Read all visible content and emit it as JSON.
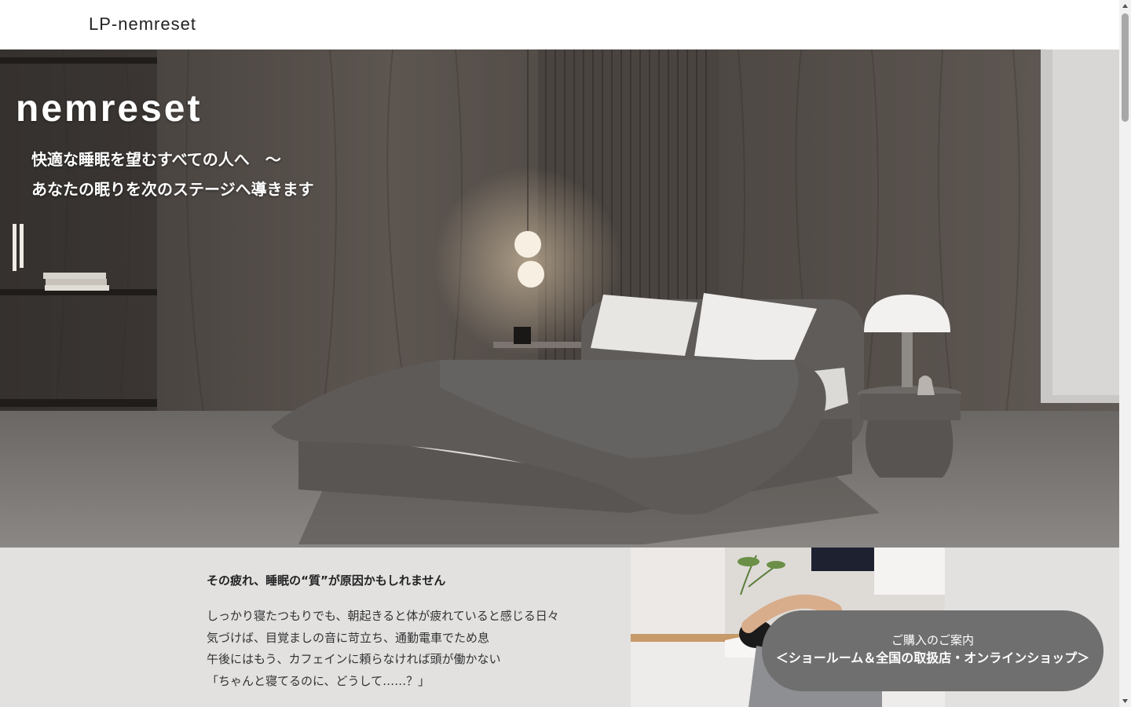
{
  "header": {
    "title": "LP-nemreset"
  },
  "hero": {
    "brand": "nemreset",
    "tagline_1": "快適な睡眠を望むすべての人へ　～",
    "tagline_2": "あなたの眠りを次のステージへ導きます"
  },
  "intro": {
    "heading": "その疲れ、睡眠の“質”が原因かもしれません",
    "lines": [
      "しっかり寝たつもりでも、朝起きると体が疲れていると感じる日々",
      "気づけば、目覚ましの音に苛立ち、通勤電車でため息",
      "午後にはもう、カフェインに頼らなければ頭が働かない",
      "「ちゃんと寝てるのに、どうして……？」"
    ]
  },
  "cta": {
    "line_1": "ご購入のご案内",
    "line_2": "＜ショールーム＆全国の取扱店・オンラインショップ＞"
  },
  "colors": {
    "cta_background": "#6f6f6f",
    "lower_background": "#e2e1e0",
    "hero_wood": "#5a5450"
  }
}
